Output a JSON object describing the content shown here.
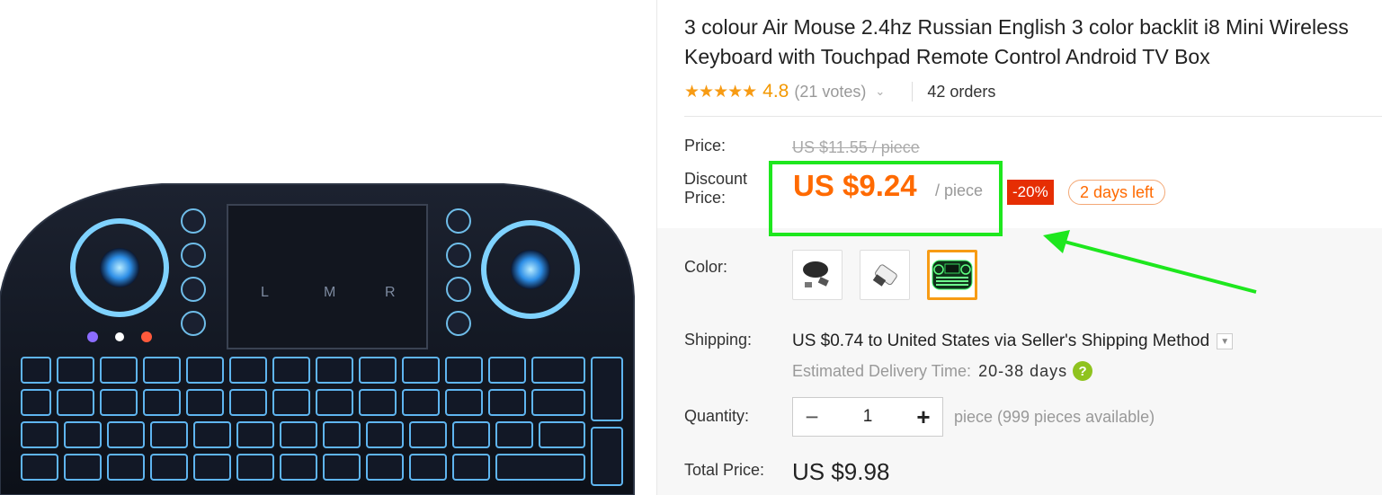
{
  "product": {
    "title_line1": "3 colour Air Mouse 2.4hz Russian English 3 color backlit i8 Mini Wireless",
    "title_line2": "Keyboard with Touchpad Remote Control Android TV Box",
    "rating": "4.8",
    "votes": "(21 votes)",
    "orders": "42 orders",
    "star_count": 5
  },
  "price": {
    "label": "Price:",
    "original": "US $11.55 / piece",
    "discount_label_1": "Discount",
    "discount_label_2": "Price:",
    "discount": "US $9.24",
    "per_unit": "/ piece",
    "discount_badge": "-20%",
    "time_left": "2 days left"
  },
  "color": {
    "label": "Color:",
    "options": [
      {
        "name": "black",
        "selected": false
      },
      {
        "name": "white",
        "selected": false
      },
      {
        "name": "green-backlit",
        "selected": true
      }
    ]
  },
  "shipping": {
    "label": "Shipping:",
    "cost": "US $0.74",
    "to_word": "to",
    "destination": "United States",
    "via_text": "via Seller's Shipping Method",
    "eta_label": "Estimated Delivery Time:",
    "eta_value": "20-38 days"
  },
  "quantity": {
    "label": "Quantity:",
    "value": "1",
    "available": "piece (999 pieces available)"
  },
  "total": {
    "label": "Total Price:",
    "value": "US $9.98"
  },
  "colors": {
    "accent_orange": "#ff6a00",
    "star": "#f79b14",
    "badge_red": "#e62e04",
    "annotation_green": "#1ee71e",
    "help_green": "#8fc31f"
  }
}
